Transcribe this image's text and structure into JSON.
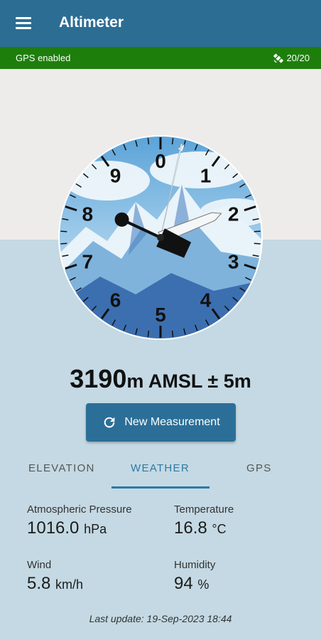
{
  "app": {
    "title": "Altimeter"
  },
  "gps": {
    "status": "GPS enabled",
    "satellites": "20/20"
  },
  "altimeter": {
    "value": "3190",
    "unit": "m AMSL ± 5m",
    "dial_labels": [
      "0",
      "1",
      "2",
      "3",
      "4",
      "5",
      "6",
      "7",
      "8",
      "9"
    ],
    "reading_m": 3190
  },
  "button": {
    "label": "New Measurement"
  },
  "tabs": [
    {
      "label": "ELEVATION"
    },
    {
      "label": "WEATHER"
    },
    {
      "label": "GPS"
    }
  ],
  "weather": {
    "pressure": {
      "label": "Atmospheric Pressure",
      "value": "1016.0",
      "unit": "hPa"
    },
    "temperature": {
      "label": "Temperature",
      "value": "16.8",
      "unit": "°C"
    },
    "wind": {
      "label": "Wind",
      "value": "5.8",
      "unit": "km/h"
    },
    "humidity": {
      "label": "Humidity",
      "value": "94",
      "unit": "%"
    }
  },
  "last_update": "Last update: 19-Sep-2023 18:44",
  "colors": {
    "appbar": "#2c6d94",
    "gpsbar": "#1e7e0c",
    "accent": "#2d7aa4"
  }
}
